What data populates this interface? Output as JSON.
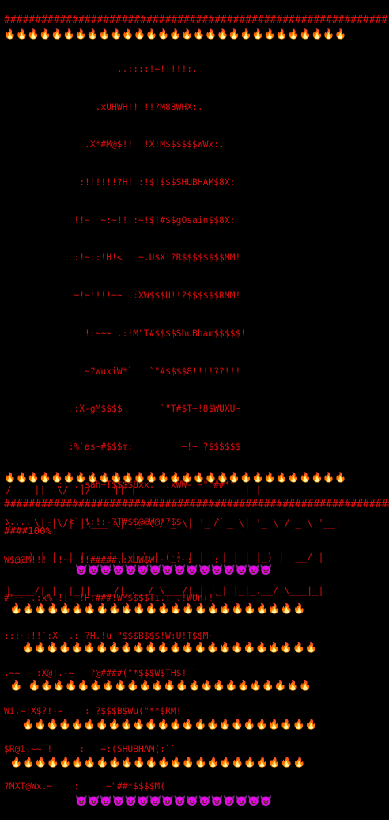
{
  "top_hash_line": "##############################################################",
  "top_flame_row": "🔥🔥🔥🔥🔥🔥🔥🔥🔥🔥🔥🔥🔥🔥🔥🔥🔥🔥🔥🔥🔥🔥🔥🔥🔥🔥🔥🔥🔥",
  "skull_art": [
    "                     ..::::!~!!!!!:.",
    "                 .xUHWH!! !!?M88WHX:.",
    "               .X*#M@$!!  !X!M$$$$$$WWx:.",
    "              :!!!!!!?H! :!$!$$$SHUBHAM$8X:",
    "             !!~  ~:~!! :~!$!#$$gOsain$$8X:",
    "             :!~::!H!<   ~.U$X!?R$$$$$$$$MM!",
    "             ~!~!!!!~~ .:XW$$$U!!?$$$$$$RMM!",
    "               !:~~~ .:!M\"T#$$$$ShuBham$$$$$!",
    "               ~?WuxiW*`   `\"#$$$$8!!!!??!!!",
    "             :X-gM$$$$       `\"T#$T~!8$WUXU~",
    "            :%`as~#$$$m:         ~!~ ?$$$$$$",
    "          :!`.-sah~T$$$$8xx.  .xWW- ~\"\"##*\"",
    ".....   -~~:<` !:!:-?T#$$@@W@*?$$      /`",
    "W$@@M!!! .!~~ !!#####.:XUW$W!~ `\"~:    :",
    "#\"~~`.:x%`!!  !H:###!WM$$$$Ti.: .!WUn+!`",
    ":::~:!!`:X~ .: ?H.!u \"$$$B$$$!W:U!T$$M~",
    ".~~   :X@!.-~   ?@####(\"*$$$W$TH$! `",
    "Wi.~!X$?!-~    : ?$$$B$Wu(\"**$RM!",
    "$R@i.~~ !     :   ~:(SHUBHAM(:``",
    "?MXT@Wx.~    :     ~\"##*$$$$M("
  ],
  "banner_art": [
    "                                                                      _",
    "  ____  __  __  ____  _                     _                        ",
    " / ___||  \\/  |/ ___|| |__   ___  _ __ ___ | |__   ___ _ __          ",
    " \\___ \\| |\\/| |\\___ \\| '_ \\ / _ \\| '_ ` _ \\| '_ \\ / _ \\ '__|  ",
    "  ___) | |  | | ___) | |_) | (_) | | | | | | |_) |  __/ |           ",
    " |____/|_|  |_||____/|_.__/ \\___/|_| |_| |_|_.__/ \\___|_|           "
  ],
  "bottom_flame_row": "🔥🔥🔥🔥🔥🔥🔥🔥🔥🔥🔥🔥🔥🔥🔥🔥🔥🔥🔥🔥🔥🔥🔥🔥🔥🔥🔥🔥🔥",
  "bottom_hash_line": "###############################################################",
  "progress_text": "####100%",
  "devil_row_top": "            😈😈😈😈😈😈😈😈😈😈😈😈😈😈😈😈",
  "fire_rows": [
    " 🔥🔥🔥🔥🔥🔥🔥🔥🔥🔥🔥🔥🔥🔥🔥🔥🔥🔥🔥🔥🔥🔥🔥🔥",
    "   🔥🔥🔥🔥🔥🔥🔥🔥🔥🔥🔥🔥🔥🔥🔥🔥🔥🔥🔥🔥🔥🔥🔥🔥",
    " 🔥 🔥🔥🔥🔥🔥🔥🔥🔥🔥🔥🔥🔥🔥🔥🔥🔥🔥🔥🔥🔥🔥🔥🔥",
    "   🔥🔥🔥🔥🔥🔥🔥🔥🔥🔥🔥🔥🔥🔥🔥🔥🔥🔥🔥🔥🔥🔥🔥🔥",
    " 🔥🔥🔥🔥🔥🔥🔥🔥🔥🔥🔥🔥🔥🔥🔥🔥🔥🔥🔥🔥🔥🔥🔥🔥"
  ],
  "devil_row_bottom": "            😈😈😈😈😈😈😈😈😈😈😈😈😈😈😈😈",
  "colors": {
    "background": "#000000",
    "ascii_red": "#e01010",
    "devil_purple": "#9b30ff"
  },
  "icons": [
    "fire-icon",
    "devil-icon"
  ]
}
